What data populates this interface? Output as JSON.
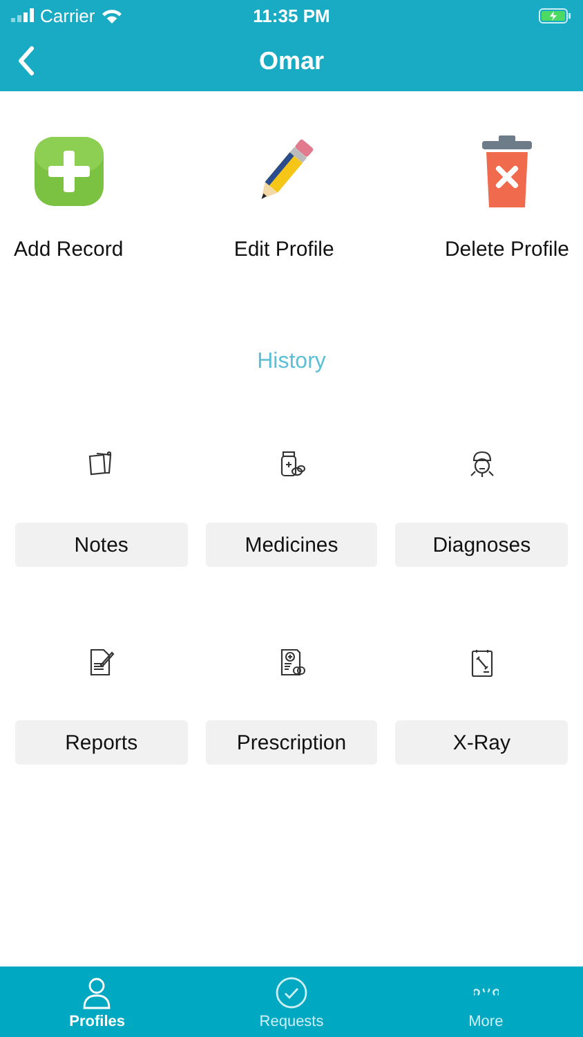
{
  "status_bar": {
    "carrier": "Carrier",
    "time": "11:35 PM"
  },
  "nav": {
    "title": "Omar"
  },
  "actions": [
    {
      "label": "Add Record"
    },
    {
      "label": "Edit Profile"
    },
    {
      "label": "Delete Profile"
    }
  ],
  "history": {
    "title": "History",
    "items": [
      {
        "label": "Notes"
      },
      {
        "label": "Medicines"
      },
      {
        "label": "Diagnoses"
      },
      {
        "label": "Reports"
      },
      {
        "label": "Prescription"
      },
      {
        "label": "X-Ray"
      }
    ]
  },
  "tab_bar": [
    {
      "label": "Profiles",
      "selected": true
    },
    {
      "label": "Requests",
      "selected": false
    },
    {
      "label": "More",
      "selected": false
    }
  ]
}
